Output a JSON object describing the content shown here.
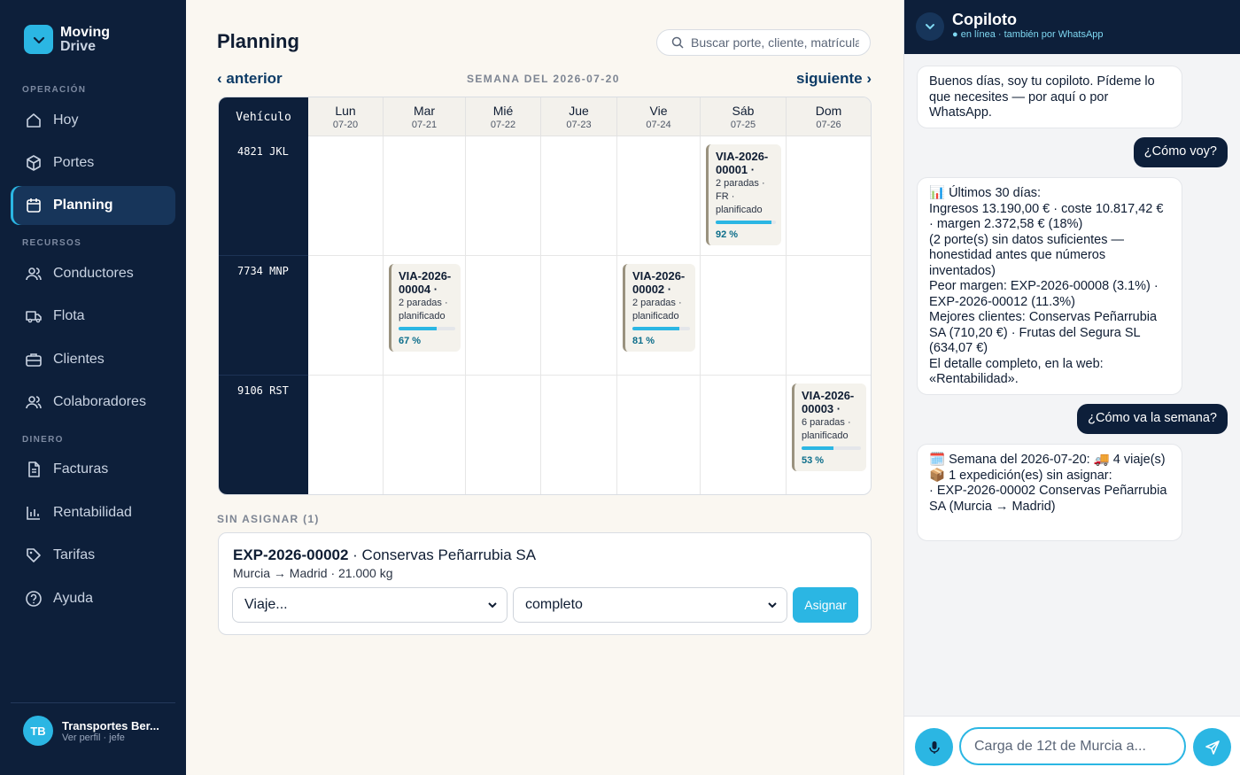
{
  "brand": {
    "line1": "Moving",
    "line2": "Drive"
  },
  "sidebar": {
    "sections": {
      "operacion": "OPERACIÓN",
      "recursos": "RECURSOS",
      "dinero": "DINERO"
    },
    "items": [
      {
        "label": "Hoy",
        "icon": "home-icon"
      },
      {
        "label": "Portes",
        "icon": "box-icon"
      },
      {
        "label": "Planning",
        "icon": "calendar-icon",
        "active": true
      },
      {
        "label": "Conductores",
        "icon": "users-icon"
      },
      {
        "label": "Flota",
        "icon": "truck-icon"
      },
      {
        "label": "Clientes",
        "icon": "briefcase-icon"
      },
      {
        "label": "Colaboradores",
        "icon": "users-icon"
      },
      {
        "label": "Facturas",
        "icon": "document-icon"
      },
      {
        "label": "Rentabilidad",
        "icon": "bar-chart-icon"
      },
      {
        "label": "Tarifas",
        "icon": "tag-icon"
      },
      {
        "label": "Ayuda",
        "icon": "help-icon"
      }
    ],
    "profile": {
      "initials": "TB",
      "name": "Transportes Ber...",
      "sub": "Ver perfil · jefe"
    }
  },
  "header": {
    "title": "Planning",
    "search_placeholder": "Buscar porte, cliente, matrícula..."
  },
  "week": {
    "prev": "‹ anterior",
    "label": "SEMANA DEL 2026-07-20",
    "next": "siguiente ›"
  },
  "grid": {
    "vehicle_header": "Vehículo",
    "days": [
      {
        "name": "Lun",
        "date": "07-20"
      },
      {
        "name": "Mar",
        "date": "07-21"
      },
      {
        "name": "Mié",
        "date": "07-22"
      },
      {
        "name": "Jue",
        "date": "07-23"
      },
      {
        "name": "Vie",
        "date": "07-24"
      },
      {
        "name": "Sáb",
        "date": "07-25"
      },
      {
        "name": "Dom",
        "date": "07-26"
      }
    ],
    "vehicles": [
      "4821 JKL",
      "7734 MNP",
      "9106 RST"
    ],
    "trips": [
      {
        "id": "VIA-2026-00001 ·",
        "sub": "2 paradas · FR · planificado",
        "progress": 0.92,
        "pct": "92 %",
        "vehicle": 0,
        "day": 5
      },
      {
        "id": "VIA-2026-00004 ·",
        "sub": "2 paradas · planificado",
        "progress": 0.67,
        "pct": "67 %",
        "vehicle": 1,
        "day": 1
      },
      {
        "id": "VIA-2026-00002 ·",
        "sub": "2 paradas · planificado",
        "progress": 0.81,
        "pct": "81 %",
        "vehicle": 1,
        "day": 4
      },
      {
        "id": "VIA-2026-00003 ·",
        "sub": "6 paradas · planificado",
        "progress": 0.53,
        "pct": "53 %",
        "vehicle": 2,
        "day": 6
      }
    ]
  },
  "unassigned": {
    "label": "SIN ASIGNAR (1)",
    "card": {
      "id": "EXP-2026-00002",
      "client": " · Conservas Peñarrubia SA",
      "route": "Murcia → Madrid · 21.000 kg",
      "trip_select": "Viaje...",
      "mode_select": "completo",
      "button": "Asignar"
    }
  },
  "copilot": {
    "title": "Copiloto",
    "status": "● en línea · también por WhatsApp",
    "messages": [
      {
        "from": "bot",
        "text": "Buenos días, soy tu copiloto. Pídeme lo que necesites — por aquí o por WhatsApp."
      },
      {
        "from": "user",
        "text": "¿Cómo voy?"
      },
      {
        "from": "bot",
        "text": "📊 Últimos 30 días:\nIngresos 13.190,00 € · coste 10.817,42 € · margen 2.372,58 € (18%)\n(2 porte(s) sin datos suficientes — honestidad antes que números inventados)\nPeor margen: EXP-2026-00008 (3.1%) · EXP-2026-00012 (11.3%)\nMejores clientes: Conservas Peñarrubia SA (710,20 €) · Frutas del Segura SL (634,07 €)\nEl detalle completo, en la web: «Rentabilidad»."
      },
      {
        "from": "user",
        "text": "¿Cómo va la semana?"
      },
      {
        "from": "bot",
        "text": "🗓️ Semana del 2026-07-20: 🚚 4 viaje(s)\n📦 1 expedición(es) sin asignar:\n · EXP-2026-00002 Conservas Peñarrubia SA (Murcia → Madrid)"
      }
    ],
    "input_placeholder": "Carga de 12t de Murcia a..."
  },
  "colors": {
    "accent": "#2bb6e3",
    "navy": "#0d1f3a",
    "cream": "#faf7f1"
  }
}
